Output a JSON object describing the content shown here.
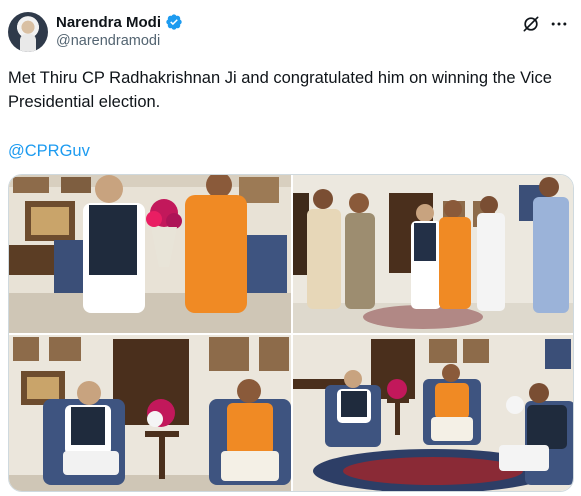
{
  "author": {
    "display_name": "Narendra Modi",
    "handle": "@narendramodi",
    "avatar_icon": "profile-photo",
    "verified_icon": "verified-badge-icon",
    "verified_color": "#1d9bf0"
  },
  "actions": {
    "grok_icon": "grok-icon",
    "more_icon": "more-options-icon"
  },
  "tweet": {
    "text": "Met Thiru CP Radhakrishnan Ji and congratulated him on winning the Vice Presidential election.",
    "mention": "@CPRGuv",
    "link_color": "#1d9bf0"
  },
  "media": {
    "photo_count": 4,
    "photos": [
      {
        "subject": "bouquet-greeting"
      },
      {
        "subject": "group-greeting"
      },
      {
        "subject": "seated-portrait-left"
      },
      {
        "subject": "seated-meeting"
      }
    ]
  }
}
